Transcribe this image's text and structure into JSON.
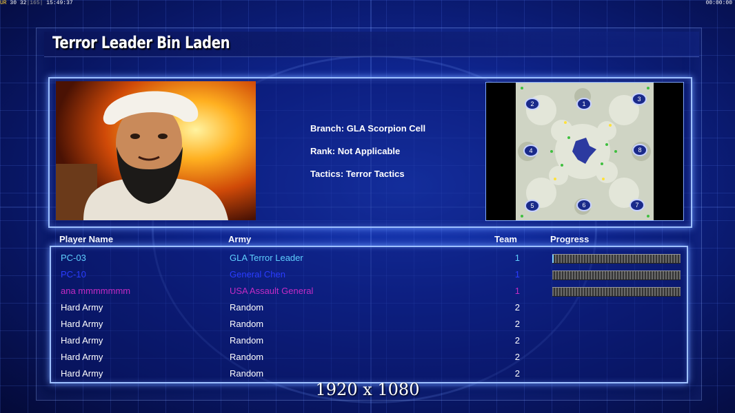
{
  "hud": {
    "left_a": "UR",
    "left_b": "30 32",
    "left_c": "165",
    "left_time": "15:49:37",
    "right_time": "00:00:00"
  },
  "title": "Terror Leader Bin Laden",
  "details": {
    "branch": "Branch: GLA Scorpion Cell",
    "rank": "Rank: Not Applicable",
    "tactics": "Tactics: Terror Tactics"
  },
  "map": {
    "slots": [
      "1",
      "2",
      "3",
      "4",
      "5",
      "6",
      "7",
      "8"
    ]
  },
  "table": {
    "headers": {
      "name": "Player Name",
      "army": "Army",
      "team": "Team",
      "progress": "Progress"
    },
    "rows": [
      {
        "name": "PC-03",
        "army": "GLA Terror Leader",
        "team": "1",
        "color": "#5fd0ff",
        "progress": 0.01
      },
      {
        "name": "PC-10",
        "army": "General Chen",
        "team": "1",
        "color": "#2a3cff",
        "progress": 0
      },
      {
        "name": "ana mmmmmmm",
        "army": "USA Assault General",
        "team": "1",
        "color": "#c42bc4",
        "progress": 0
      },
      {
        "name": "Hard Army",
        "army": "Random",
        "team": "2",
        "color": "#ffffff"
      },
      {
        "name": "Hard Army",
        "army": "Random",
        "team": "2",
        "color": "#ffffff"
      },
      {
        "name": "Hard Army",
        "army": "Random",
        "team": "2",
        "color": "#ffffff"
      },
      {
        "name": "Hard Army",
        "army": "Random",
        "team": "2",
        "color": "#ffffff"
      },
      {
        "name": "Hard Army",
        "army": "Random",
        "team": "2",
        "color": "#ffffff"
      }
    ]
  },
  "resolution": "1920 x 1080"
}
